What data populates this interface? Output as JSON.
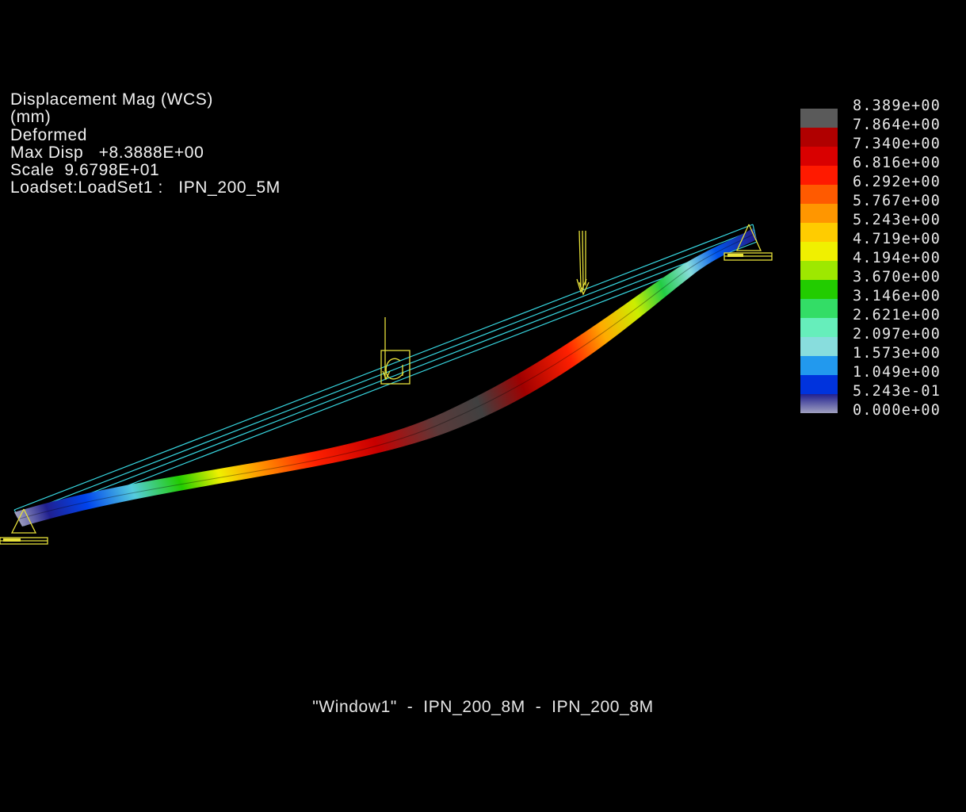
{
  "info": {
    "result_type": "Displacement Mag (WCS)",
    "units": "(mm)",
    "mode": "Deformed",
    "max_disp": "Max Disp   +8.3888E+00",
    "scale": "Scale  9.6798E+01",
    "loadset": "Loadset:LoadSet1 :   IPN_200_5M"
  },
  "legend": {
    "labels": [
      "8.389e+00",
      "7.864e+00",
      "7.340e+00",
      "6.816e+00",
      "6.292e+00",
      "5.767e+00",
      "5.243e+00",
      "4.719e+00",
      "4.194e+00",
      "3.670e+00",
      "3.146e+00",
      "2.621e+00",
      "2.097e+00",
      "1.573e+00",
      "1.049e+00",
      "5.243e-01",
      "0.000e+00"
    ],
    "colors": [
      "#5a5a5a",
      "#b00000",
      "#d90000",
      "#ff1a00",
      "#ff5a00",
      "#ff9600",
      "#ffcc00",
      "#f0f000",
      "#9ee800",
      "#22cc00",
      "#33dd66",
      "#66eebb",
      "#88dddd",
      "#2299ee",
      "#0033dd",
      "#202090",
      "#a0a0c0"
    ]
  },
  "caption": "\"Window1\"  -  IPN_200_8M  -  IPN_200_8M",
  "colors": {
    "background": "#000000",
    "wireframe": "#37d6e0",
    "constraint": "#e8e23a"
  }
}
